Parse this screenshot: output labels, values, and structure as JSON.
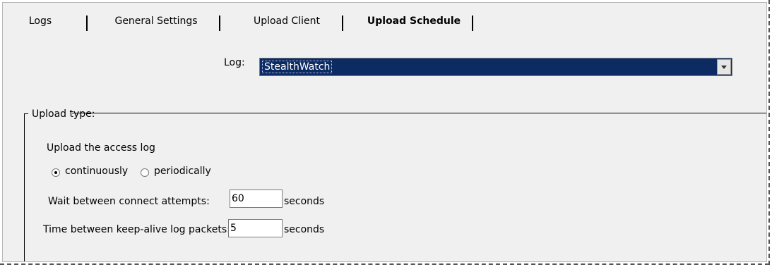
{
  "tabs": [
    {
      "label": "Logs"
    },
    {
      "label": "General Settings"
    },
    {
      "label": "Upload Client"
    },
    {
      "label": "Upload Schedule",
      "active": true
    }
  ],
  "log_selector": {
    "label": "Log:",
    "value": "StealthWatch"
  },
  "upload_type": {
    "group_title": "Upload type:",
    "access_log_label": "Upload the access log",
    "options": [
      {
        "label": "continuously",
        "selected": true
      },
      {
        "label": "periodically",
        "selected": false
      }
    ]
  },
  "wait_between": {
    "label": "Wait between connect attempts:",
    "value": "60",
    "unit": "seconds"
  },
  "keepalive": {
    "label": "Time between keep-alive log packets:",
    "value": "5",
    "unit": "seconds"
  },
  "colors": {
    "selection_bg": "#0c2b62",
    "panel_bg": "#f0f0f0"
  }
}
